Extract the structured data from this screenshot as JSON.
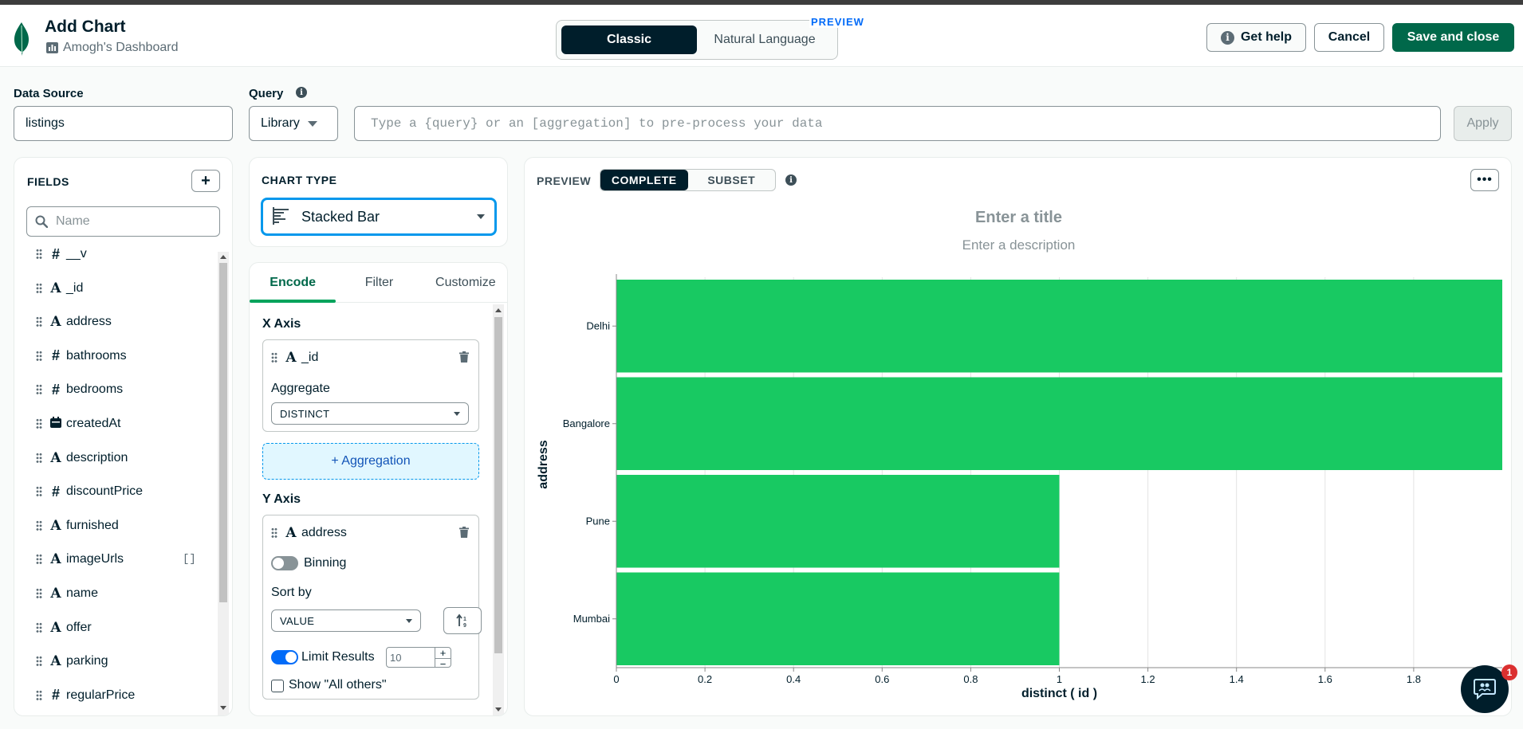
{
  "header": {
    "title": "Add Chart",
    "dashboard": "Amogh's Dashboard",
    "mode_tabs": [
      "Classic",
      "Natural Language"
    ],
    "active_mode": "Classic",
    "preview_tag": "PREVIEW",
    "help_label": "Get help",
    "cancel_label": "Cancel",
    "save_label": "Save and close"
  },
  "data_source": {
    "label": "Data Source",
    "value": "listings"
  },
  "query": {
    "label": "Query",
    "library_label": "Library",
    "placeholder": "Type a {query} or an [aggregation] to pre-process your data",
    "apply_label": "Apply"
  },
  "fields": {
    "title": "FIELDS",
    "search_placeholder": "Name",
    "items": [
      {
        "type": "#",
        "name": "__v"
      },
      {
        "type": "A",
        "name": "_id"
      },
      {
        "type": "A",
        "name": "address"
      },
      {
        "type": "#",
        "name": "bathrooms"
      },
      {
        "type": "#",
        "name": "bedrooms"
      },
      {
        "type": "date",
        "name": "createdAt"
      },
      {
        "type": "A",
        "name": "description"
      },
      {
        "type": "#",
        "name": "discountPrice"
      },
      {
        "type": "A",
        "name": "furnished"
      },
      {
        "type": "A",
        "name": "imageUrls",
        "badge": "[]"
      },
      {
        "type": "A",
        "name": "name"
      },
      {
        "type": "A",
        "name": "offer"
      },
      {
        "type": "A",
        "name": "parking"
      },
      {
        "type": "#",
        "name": "regularPrice"
      }
    ]
  },
  "chart_type": {
    "title": "CHART TYPE",
    "value": "Stacked Bar"
  },
  "encode": {
    "tabs": [
      "Encode",
      "Filter",
      "Customize"
    ],
    "active_tab": "Encode",
    "x_axis": {
      "label": "X Axis",
      "field": "_id",
      "aggregate_label": "Aggregate",
      "aggregate_value": "DISTINCT"
    },
    "aggregation_button": "+ Aggregation",
    "y_axis": {
      "label": "Y Axis",
      "field": "address",
      "binning_label": "Binning",
      "binning_on": false,
      "sort_label": "Sort by",
      "sort_value": "VALUE",
      "limit_label": "Limit Results",
      "limit_on": true,
      "limit_value": "10",
      "show_others_label": "Show \"All others\""
    }
  },
  "preview": {
    "label": "PREVIEW",
    "modes": [
      "COMPLETE",
      "SUBSET"
    ],
    "active_mode": "COMPLETE",
    "title_placeholder": "Enter a title",
    "description_placeholder": "Enter a description"
  },
  "chat": {
    "badge": "1"
  },
  "colors": {
    "bar": "#18c962",
    "accent": "#00684a",
    "dark": "#001e2b",
    "focus": "#0498ec"
  },
  "chart_data": {
    "type": "bar",
    "orientation": "horizontal",
    "categories": [
      "Delhi",
      "Bangalore",
      "Pune",
      "Mumbai"
    ],
    "values": [
      2,
      2,
      1,
      1
    ],
    "xlabel": "distinct ( id )",
    "ylabel": "address",
    "xlim": [
      0,
      2
    ],
    "xticks": [
      "0",
      "0.2",
      "0.4",
      "0.6",
      "0.8",
      "1",
      "1.2",
      "1.4",
      "1.6",
      "1.8"
    ],
    "grid": true
  }
}
